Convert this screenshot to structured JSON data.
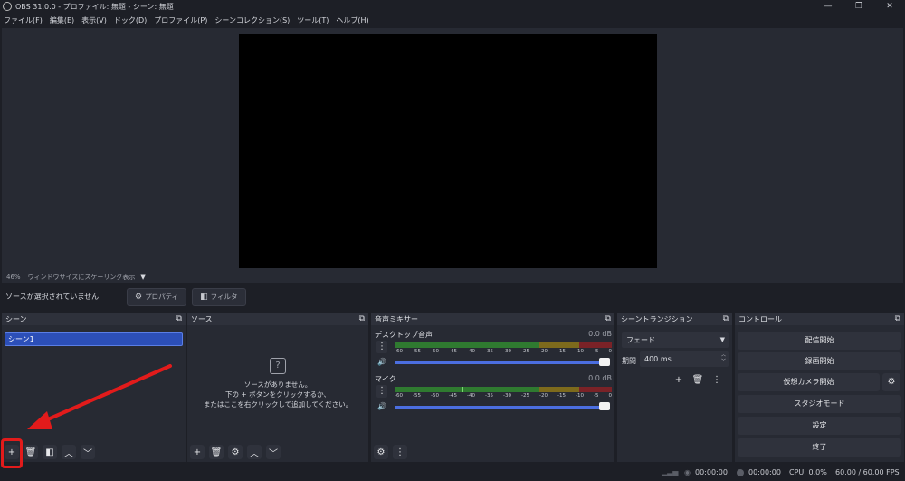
{
  "window": {
    "title": "OBS 31.0.0 - プロファイル: 無題 - シーン: 無題",
    "controls": {
      "minimize": "—",
      "maximize": "❐",
      "close": "✕"
    }
  },
  "menu": [
    "ファイル(F)",
    "編集(E)",
    "表示(V)",
    "ドック(D)",
    "プロファイル(P)",
    "シーンコレクション(S)",
    "ツール(T)",
    "ヘルプ(H)"
  ],
  "preview": {
    "zoom": "46%",
    "scale_mode": "ウィンドウサイズにスケーリング表示"
  },
  "source_bar": {
    "status": "ソースが選択されていません",
    "properties_label": "プロパティ",
    "filters_label": "フィルタ"
  },
  "scenes": {
    "title": "シーン",
    "items": [
      "シーン1"
    ]
  },
  "sources": {
    "title": "ソース",
    "empty_lines": [
      "ソースがありません。",
      "下の + ボタンをクリックするか、",
      "またはここを右クリックして追加してください。"
    ]
  },
  "mixer": {
    "title": "音声ミキサー",
    "ticks": [
      "-60",
      "-55",
      "-50",
      "-45",
      "-40",
      "-35",
      "-30",
      "-25",
      "-20",
      "-15",
      "-10",
      "-5",
      "0"
    ],
    "channels": [
      {
        "name": "デスクトップ音声",
        "db": "0.0 dB"
      },
      {
        "name": "マイク",
        "db": "0.0 dB"
      }
    ]
  },
  "transitions": {
    "title": "シーントランジション",
    "selected": "フェード",
    "duration_label": "期間",
    "duration_value": "400 ms"
  },
  "controls": {
    "title": "コントロール",
    "start_streaming": "配信開始",
    "start_recording": "録画開始",
    "virtual_camera": "仮想カメラ開始",
    "studio_mode": "スタジオモード",
    "settings": "設定",
    "exit": "終了"
  },
  "status": {
    "stream_time": "00:00:00",
    "record_time": "00:00:00",
    "cpu": "CPU: 0.0%",
    "fps": "60.00 / 60.00 FPS"
  },
  "colors": {
    "accent": "#2c4fb8",
    "annotation": "#e21b1b"
  }
}
